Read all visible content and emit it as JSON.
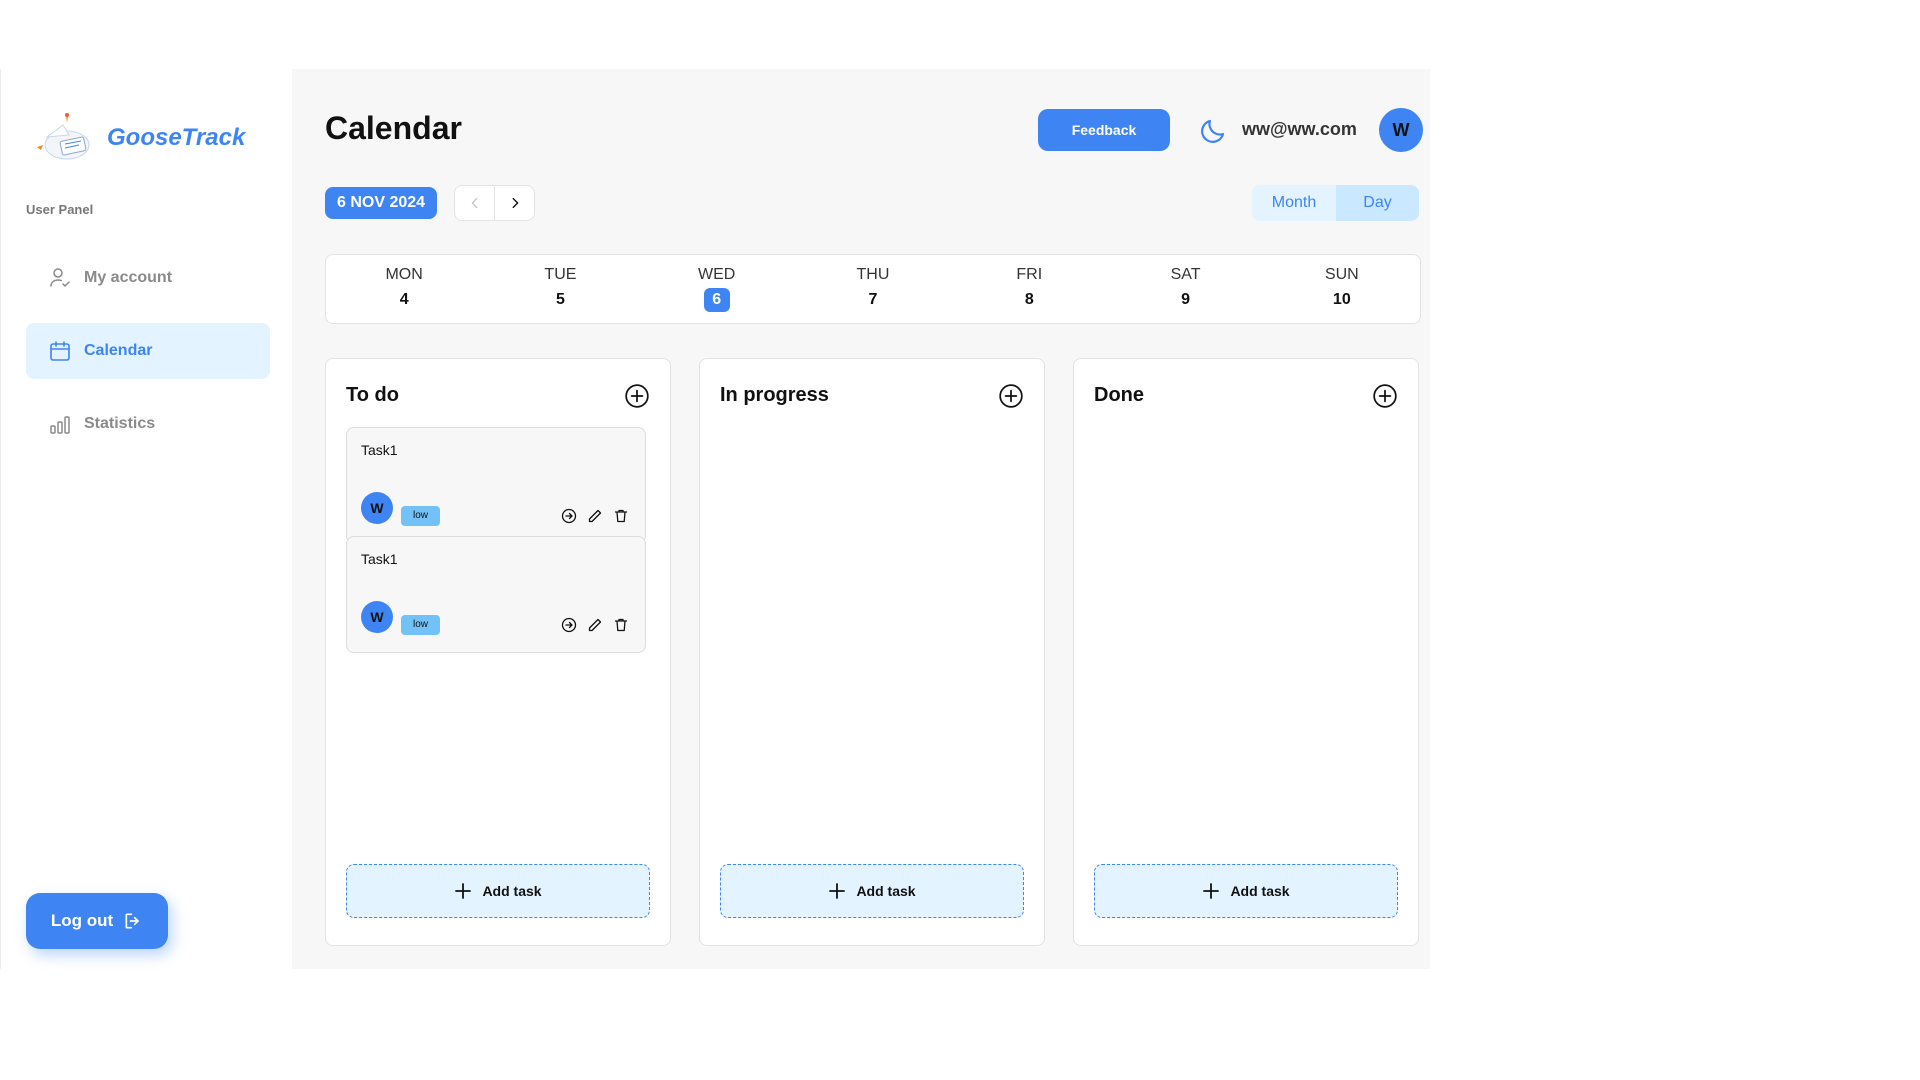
{
  "brand": {
    "name": "GooseTrack"
  },
  "sidebar": {
    "panel_label": "User Panel",
    "items": [
      {
        "label": "My account",
        "icon": "user-check-icon",
        "active": false
      },
      {
        "label": "Calendar",
        "icon": "calendar-icon",
        "active": true
      },
      {
        "label": "Statistics",
        "icon": "bar-chart-icon",
        "active": false
      }
    ],
    "logout_label": "Log out"
  },
  "header": {
    "title": "Calendar",
    "feedback_label": "Feedback",
    "user_email": "ww@ww.com",
    "avatar_initial": "W"
  },
  "toolbar": {
    "date": "6 NOV 2024",
    "view_month": "Month",
    "view_day": "Day",
    "active_view": "Day"
  },
  "week": [
    {
      "name": "MON",
      "num": "4"
    },
    {
      "name": "TUE",
      "num": "5"
    },
    {
      "name": "WED",
      "num": "6",
      "active": true
    },
    {
      "name": "THU",
      "num": "7"
    },
    {
      "name": "FRI",
      "num": "8"
    },
    {
      "name": "SAT",
      "num": "9"
    },
    {
      "name": "SUN",
      "num": "10"
    }
  ],
  "columns": [
    {
      "title": "To do",
      "add_label": "Add task",
      "tasks": [
        {
          "title": "Task1",
          "avatar": "W",
          "priority": "low"
        },
        {
          "title": "Task1",
          "avatar": "W",
          "priority": "low"
        }
      ]
    },
    {
      "title": "In progress",
      "add_label": "Add task",
      "tasks": []
    },
    {
      "title": "Done",
      "add_label": "Add task",
      "tasks": []
    }
  ],
  "colors": {
    "accent": "#3e85f3",
    "accent_light": "#e3f3ff",
    "priority_low": "#72c2f8"
  }
}
